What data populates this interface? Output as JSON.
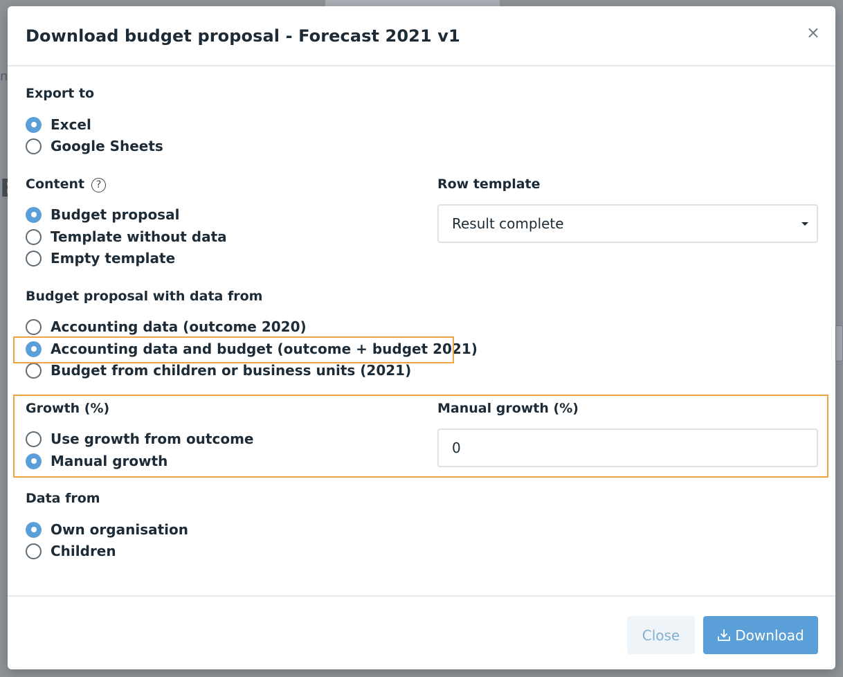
{
  "modal": {
    "title": "Download budget proposal - Forecast 2021 v1",
    "close_glyph": "×"
  },
  "export_to": {
    "label": "Export to",
    "options": [
      {
        "label": "Excel",
        "checked": true
      },
      {
        "label": "Google Sheets",
        "checked": false
      }
    ]
  },
  "content": {
    "label": "Content",
    "help_glyph": "?",
    "options": [
      {
        "label": "Budget proposal",
        "checked": true
      },
      {
        "label": "Template without data",
        "checked": false
      },
      {
        "label": "Empty template",
        "checked": false
      }
    ]
  },
  "row_template": {
    "label": "Row template",
    "selected": "Result complete"
  },
  "data_source": {
    "label": "Budget proposal with data from",
    "options": [
      {
        "label": "Accounting data (outcome 2020)",
        "checked": false
      },
      {
        "label": "Accounting data and budget (outcome + budget 2021)",
        "checked": true
      },
      {
        "label": "Budget from children or business units (2021)",
        "checked": false
      }
    ]
  },
  "growth": {
    "label": "Growth (%)",
    "options": [
      {
        "label": "Use growth from outcome",
        "checked": false
      },
      {
        "label": "Manual growth",
        "checked": true
      }
    ]
  },
  "manual_growth": {
    "label": "Manual growth (%)",
    "value": "0"
  },
  "data_from": {
    "label": "Data from",
    "options": [
      {
        "label": "Own organisation",
        "checked": true
      },
      {
        "label": "Children",
        "checked": false
      }
    ]
  },
  "footer": {
    "close_label": "Close",
    "download_label": "Download"
  },
  "colors": {
    "accent": "#5b9fd8",
    "highlight": "#f0a343"
  },
  "icons": {
    "close": "close-icon",
    "help": "help-circle-icon",
    "caret": "caret-down-icon",
    "download": "download-icon"
  }
}
